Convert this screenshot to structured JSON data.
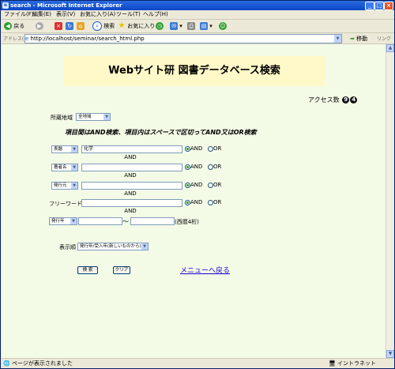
{
  "window": {
    "title": "search - Microsoft Internet Explorer"
  },
  "menu": [
    "ファイル(F)",
    "編集(E)",
    "表示(V)",
    "お気に入り(A)",
    "ツール(T)",
    "ヘルプ(H)"
  ],
  "toolbar": {
    "back": "戻る",
    "search": "検索",
    "favorites": "お気に入り"
  },
  "address": {
    "label": "アドレス(D)",
    "url": "http://localhost/seminar/search_html.php",
    "go": "移動",
    "links": "リンク"
  },
  "page": {
    "banner": "Webサイト研 図書データベース検索",
    "access_label": "アクセス数",
    "access_digits": [
      "9",
      "4"
    ],
    "region_label": "所蔵地域",
    "region_value": "全地域",
    "notice": "項目間はAND検索、項目内はスペースで区切ってAND又はOR検索",
    "rows": [
      {
        "field": "表題",
        "value": "化学",
        "and": "AND",
        "or": "OR"
      },
      {
        "field": "著者名",
        "value": "",
        "and": "AND",
        "or": "OR"
      },
      {
        "field": "発行元",
        "value": "",
        "and": "AND",
        "or": "OR"
      }
    ],
    "and_connector": "AND",
    "freeword_label": "フリーワード",
    "freeword_value": "",
    "freeword_and": "AND",
    "freeword_or": "OR",
    "year_field": "発行年",
    "year_from": "",
    "year_to": "",
    "tilde": "〜",
    "year_hint": "(西暦4桁)",
    "sort_label": "表示順",
    "sort_value": "発行年/受入年(新しいものから)",
    "search_button": "検 索",
    "clear_button": "クリア",
    "back_link": "メニューへ戻る"
  },
  "status": {
    "left": "ページが表示されました",
    "zone": "イントラネット"
  }
}
